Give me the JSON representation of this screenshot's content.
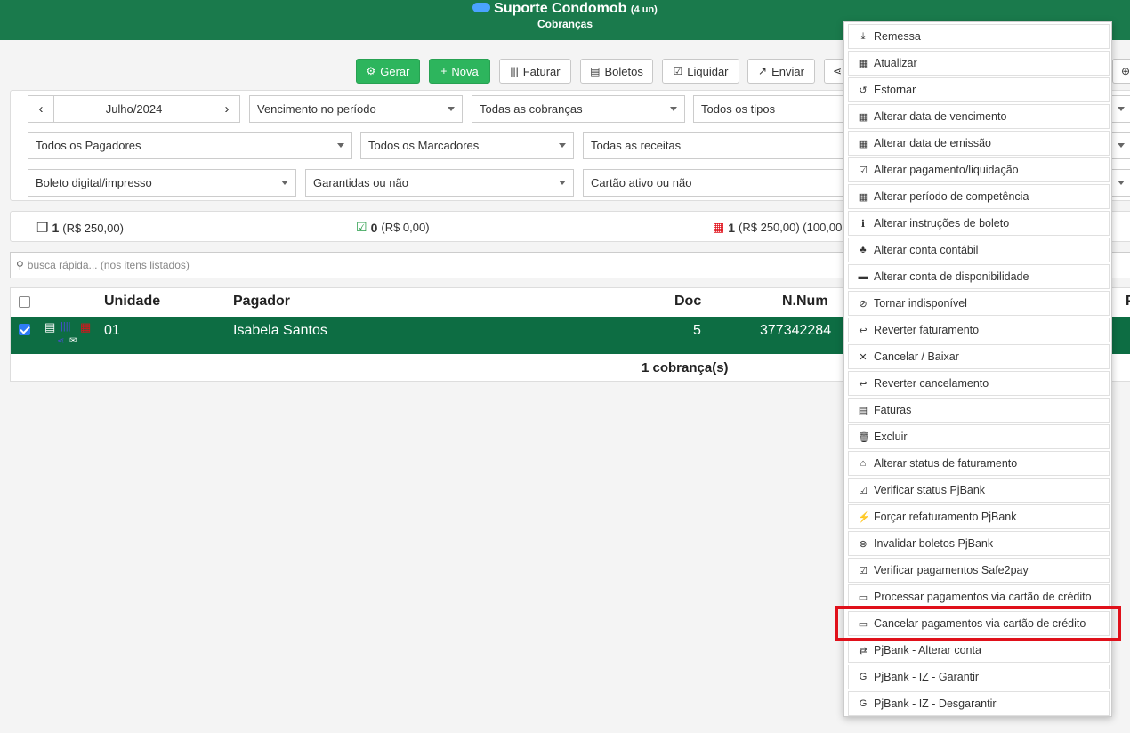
{
  "header": {
    "title": "Suporte Condomob",
    "units": "(4 un)",
    "subtitle": "Cobranças"
  },
  "toolbar": {
    "gerar": "Gerar",
    "nova": "Nova",
    "faturar": "Faturar",
    "boletos": "Boletos",
    "liquidar": "Liquidar",
    "enviar": "Enviar"
  },
  "filters": {
    "month": "Julho/2024",
    "vencimento": "Vencimento no período",
    "cobrancas": "Todas as cobranças",
    "tipos": "Todos os tipos",
    "pagadores": "Todos os Pagadores",
    "marcadores": "Todos os Marcadores",
    "receitas": "Todas as receitas",
    "boleto": "Boleto digital/impresso",
    "garantidas": "Garantidas ou não",
    "cartao": "Cartão ativo ou não"
  },
  "summary": {
    "total_count": "1",
    "total_value": "(R$ 250,00)",
    "paid_count": "0",
    "paid_value": "(R$ 0,00)",
    "due_count": "1",
    "due_value": "(R$ 250,00) (100,00"
  },
  "search": {
    "placeholder": "busca rápida... (nos itens listados)"
  },
  "table": {
    "headers": {
      "unidade": "Unidade",
      "pagador": "Pagador",
      "doc": "Doc",
      "nnum": "N.Num",
      "extra": "P"
    },
    "row": {
      "unidade": "01",
      "pagador": "Isabela Santos",
      "doc": "5",
      "nnum": "377342284"
    },
    "footer": "1 cobrança(s)"
  },
  "menu": {
    "items": [
      {
        "label": "Remessa",
        "icon": "download-icon"
      },
      {
        "label": "Atualizar",
        "icon": "calculator-icon"
      },
      {
        "label": "Estornar",
        "icon": "undo-icon"
      },
      {
        "label": "Alterar data de vencimento",
        "icon": "calendar-icon"
      },
      {
        "label": "Alterar data de emissão",
        "icon": "calendar-icon"
      },
      {
        "label": "Alterar pagamento/liquidação",
        "icon": "check-square-icon"
      },
      {
        "label": "Alterar período de competência",
        "icon": "calendar-icon"
      },
      {
        "label": "Alterar instruções de boleto",
        "icon": "info-icon"
      },
      {
        "label": "Alterar conta contábil",
        "icon": "sitemap-icon"
      },
      {
        "label": "Alterar conta de disponibilidade",
        "icon": "archive-icon"
      },
      {
        "label": "Tornar indisponível",
        "icon": "ban-icon"
      },
      {
        "label": "Reverter faturamento",
        "icon": "reply-icon"
      },
      {
        "label": "Cancelar / Baixar",
        "icon": "times-icon"
      },
      {
        "label": "Reverter cancelamento",
        "icon": "reply-icon"
      },
      {
        "label": "Faturas",
        "icon": "print-icon"
      },
      {
        "label": "Excluir",
        "icon": "trash-icon"
      },
      {
        "label": "Alterar status de faturamento",
        "icon": "bank-icon"
      },
      {
        "label": "Verificar status PjBank",
        "icon": "check-square-icon"
      },
      {
        "label": "Forçar refaturamento PjBank",
        "icon": "bolt-icon"
      },
      {
        "label": "Invalidar boletos PjBank",
        "icon": "times-circle-icon"
      },
      {
        "label": "Verificar pagamentos Safe2pay",
        "icon": "check-square-icon"
      },
      {
        "label": "Processar pagamentos via cartão de crédito",
        "icon": "credit-card-icon"
      },
      {
        "label": "Cancelar pagamentos via cartão de crédito",
        "icon": "credit-card-icon"
      },
      {
        "label": "PjBank - Alterar conta",
        "icon": "exchange-icon"
      },
      {
        "label": "PjBank - IZ - Garantir",
        "icon": "google-icon"
      },
      {
        "label": "PjBank - IZ - Desgarantir",
        "icon": "google-icon"
      }
    ]
  },
  "colors": {
    "header_bg": "#1a7a4c",
    "row_selected_bg": "#0d6d43",
    "button_green": "#2db55d",
    "highlight_border": "#e0101a"
  }
}
